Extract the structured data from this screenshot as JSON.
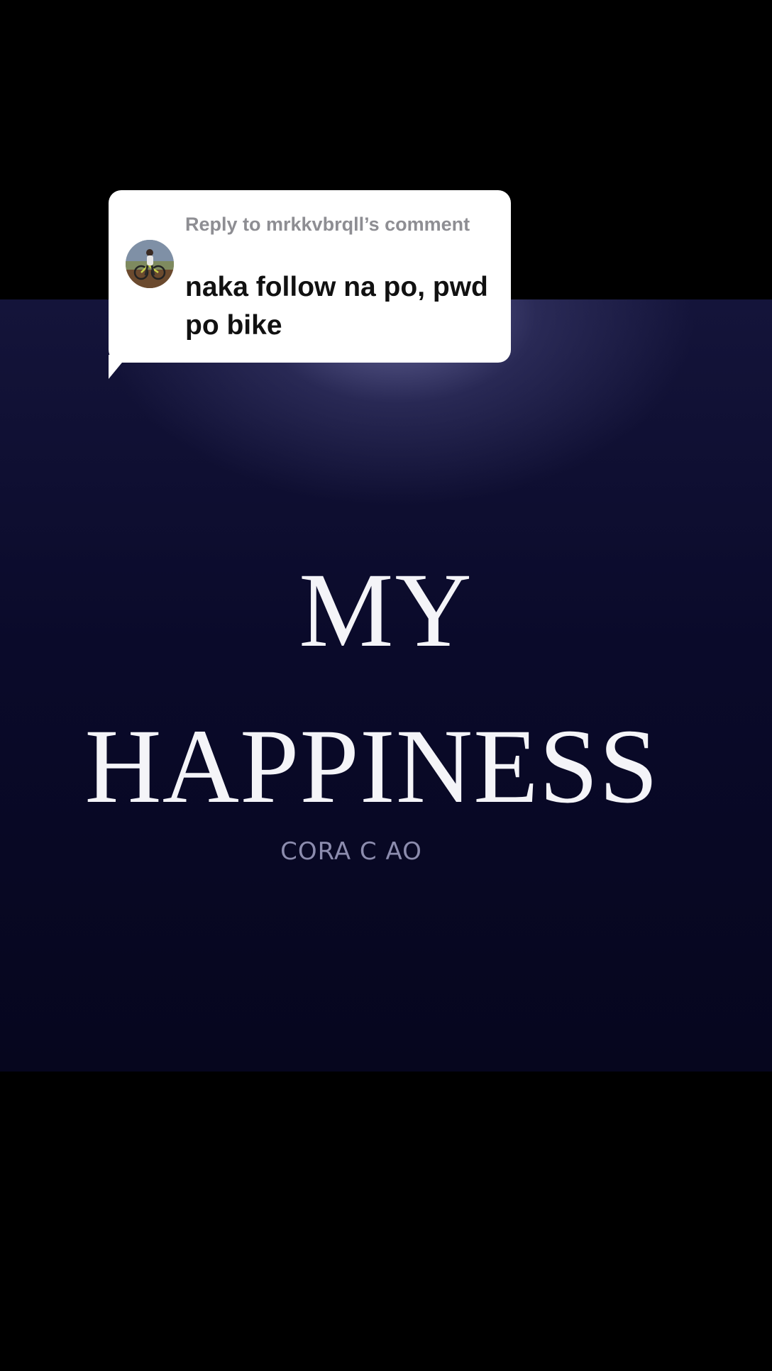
{
  "reply_sticker": {
    "header": "Reply to mrkkvbrqll’s comment",
    "comment_text": "naka follow na po, pwd po bike"
  },
  "video": {
    "title_line1": "MY",
    "title_line2": "HAPPINESS",
    "credit": "CORA C AO"
  },
  "colors": {
    "background": "#000000",
    "video_bg": "#0a0a2a",
    "title_text": "#f4f4f8",
    "credit_text": "#8c8cae",
    "sticker_bg": "#ffffff",
    "sticker_header": "#8e8e93",
    "sticker_text": "#111111"
  },
  "icons": {
    "avatar": "user-avatar-cyclist"
  }
}
